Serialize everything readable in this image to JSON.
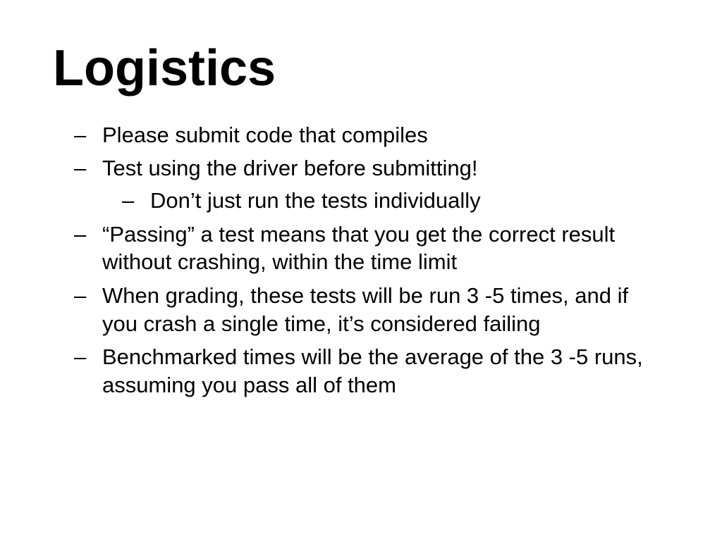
{
  "slide": {
    "title": "Logistics",
    "bullets": {
      "b1": "Please submit code that compiles",
      "b2": "Test using the driver before submitting!",
      "b2_sub1": "Don’t just run the tests individually",
      "b3": "“Passing” a test means that you get the correct result without crashing, within the time limit",
      "b4": "When grading, these tests will be run 3 -5 times, and if you crash a single time, it’s considered failing",
      "b5": "Benchmarked times will be the average of the 3 -5 runs, assuming you pass all of them"
    }
  }
}
